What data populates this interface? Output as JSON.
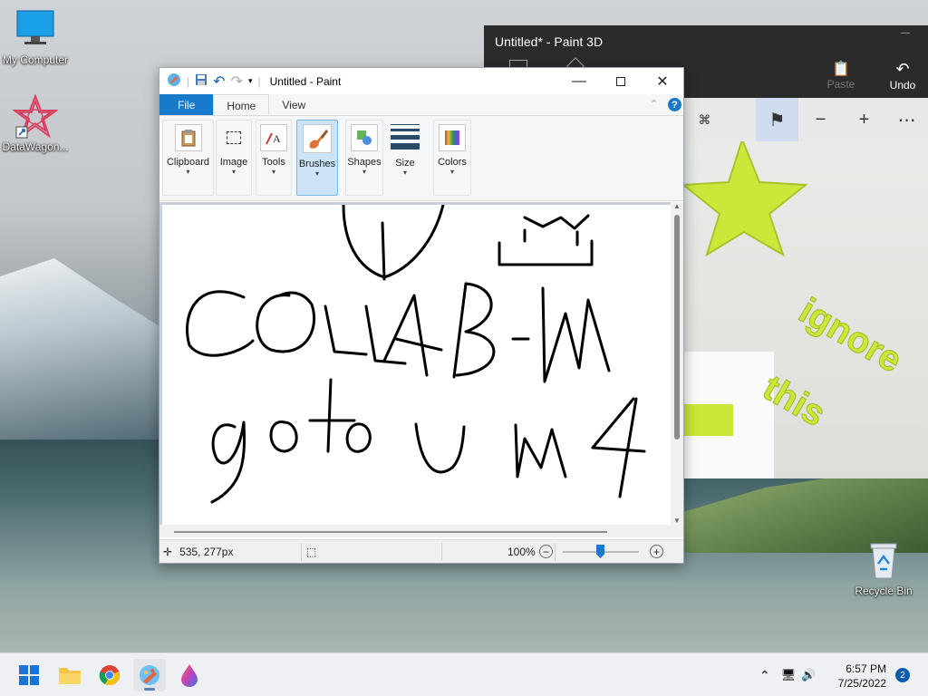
{
  "desktop": {
    "icons": [
      {
        "label": "My Computer",
        "icon": "monitor-icon"
      },
      {
        "label": "DataWagon...",
        "icon": "datawagon-icon"
      },
      {
        "label": "Recycle Bin",
        "icon": "recycle-bin-icon"
      }
    ]
  },
  "paint3d": {
    "title": "Untitled* - Paint 3D",
    "toolbar": {
      "paste_label": "Paste",
      "undo_label": "Undo"
    },
    "canvas_text": [
      "ignore",
      "this"
    ],
    "colors": {
      "title_bg": "#2b2b2b",
      "text_3d": "#c9e83a"
    }
  },
  "paint": {
    "title": "Untitled - Paint",
    "tabs": [
      {
        "label": "File"
      },
      {
        "label": "Home"
      },
      {
        "label": "View"
      }
    ],
    "ribbon": [
      {
        "label": "Clipboard",
        "icon": "clipboard-icon"
      },
      {
        "label": "Image",
        "icon": "select-icon"
      },
      {
        "label": "Tools",
        "icon": "tools-icon"
      },
      {
        "label": "Brushes",
        "icon": "brush-icon"
      },
      {
        "label": "Shapes",
        "icon": "shapes-icon"
      },
      {
        "label": "Size",
        "icon": "size-icon"
      },
      {
        "label": "Colors",
        "icon": "colors-icon"
      }
    ],
    "status": {
      "position": "535, 277px",
      "zoom": "100%"
    },
    "colors": {
      "file_tab": "#1979ca",
      "selected_group": "#cce4f7"
    }
  },
  "taskbar": {
    "apps": [
      {
        "name": "Start",
        "icon": "windows-start-icon"
      },
      {
        "name": "File Explorer",
        "icon": "folder-icon"
      },
      {
        "name": "Chrome",
        "icon": "chrome-icon"
      },
      {
        "name": "Paint",
        "icon": "paint-icon"
      },
      {
        "name": "Paint 3D",
        "icon": "paint3d-icon"
      }
    ],
    "time": "6:57 PM",
    "date": "7/25/2022",
    "notification_count": "2"
  }
}
